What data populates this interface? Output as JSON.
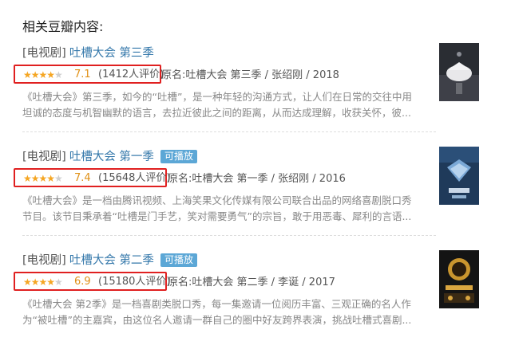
{
  "heading": "相关豆瓣内容:",
  "results": [
    {
      "category": "[电视剧]",
      "title": "吐槽大会 第三季",
      "playable": "",
      "score": "7.1",
      "rating_count": "(1412人评价)",
      "meta": "原名:吐槽大会 第三季 / 张绍刚 / 2018",
      "desc_lines": [
        "《吐槽大会》第三季，如今的“吐槽”，是一种年轻的沟通方式，让人们在日常的交往中用",
        "坦诚的态度与机智幽默的语言，去拉近彼此之间的距离，从而达成理解，收获关怀，彼..."
      ],
      "poster_icon": "poster-doves"
    },
    {
      "category": "[电视剧]",
      "title": "吐槽大会 第一季",
      "playable": "可播放",
      "score": "7.4",
      "rating_count": "(15648人评价)",
      "meta": "原名:吐槽大会 第一季 / 张绍刚 / 2016",
      "desc_lines": [
        "《吐槽大会》是一档由腾讯视频、上海笑果文化传媒有限公司联合出品的网络喜剧脱口秀",
        "节目。该节目秉承着“吐槽是门手艺，笑对需要勇气”的宗旨，敢于用恶毒、犀利的言语..."
      ],
      "poster_icon": "poster-trophy"
    },
    {
      "category": "[电视剧]",
      "title": "吐槽大会 第二季",
      "playable": "可播放",
      "score": "6.9",
      "rating_count": "(15180人评价)",
      "meta": "原名:吐槽大会 第二季 / 李诞 / 2017",
      "desc_lines": [
        "《吐槽大会 第2季》是一档喜剧类脱口秀，每一集邀请一位阅历丰富、三观正确的名人作",
        "为“被吐槽”的主嘉宾，由这位名人邀请一群自己的圈中好友跨界表演，挑战吐槽式喜剧..."
      ],
      "poster_icon": "poster-stage"
    }
  ],
  "star_fill": [
    3.5,
    3.5,
    3.5
  ],
  "colors": {
    "link": "#3377aa",
    "highlight": "#e02020",
    "star": "#f5a623",
    "badge": "#5ca7d6"
  }
}
